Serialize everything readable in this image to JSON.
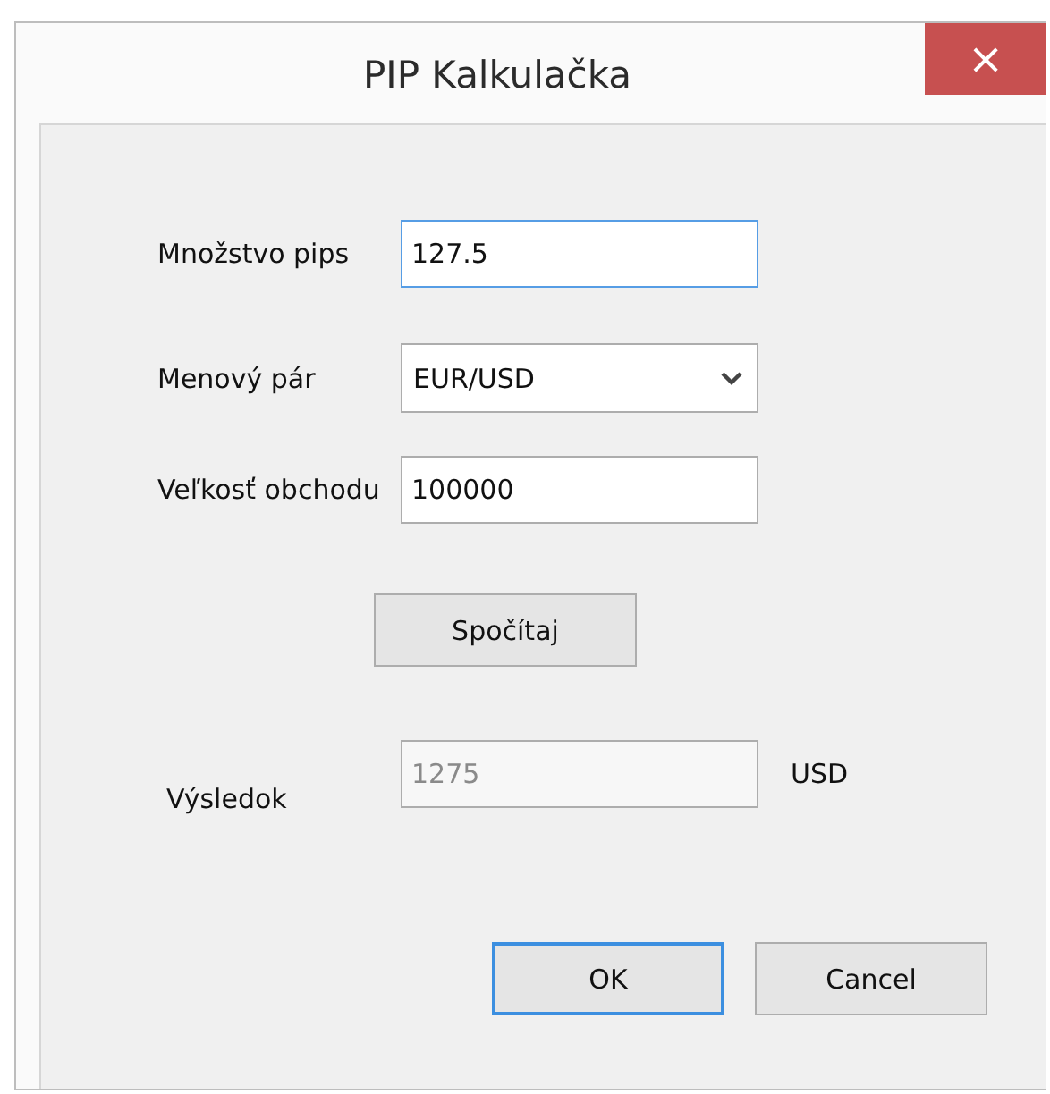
{
  "window": {
    "title": "PIP Kalkulačka",
    "close": "×"
  },
  "fields": [
    {
      "kind": "text",
      "label": "Množstvo pips",
      "value": "127.5",
      "focused": true
    },
    {
      "kind": "select",
      "label": "Menový pár",
      "value": "EUR/USD",
      "focused": false
    },
    {
      "kind": "text",
      "label": "Veľkosť obchodu",
      "value": "100000",
      "focused": false
    }
  ],
  "calculate_button": "Spočítaj",
  "result": {
    "label": "Výsledok",
    "value": "1275",
    "disabled": true,
    "unit": "USD"
  },
  "buttons": [
    {
      "label": "OK",
      "focused": true
    },
    {
      "label": "Cancel",
      "focused": false
    }
  ]
}
